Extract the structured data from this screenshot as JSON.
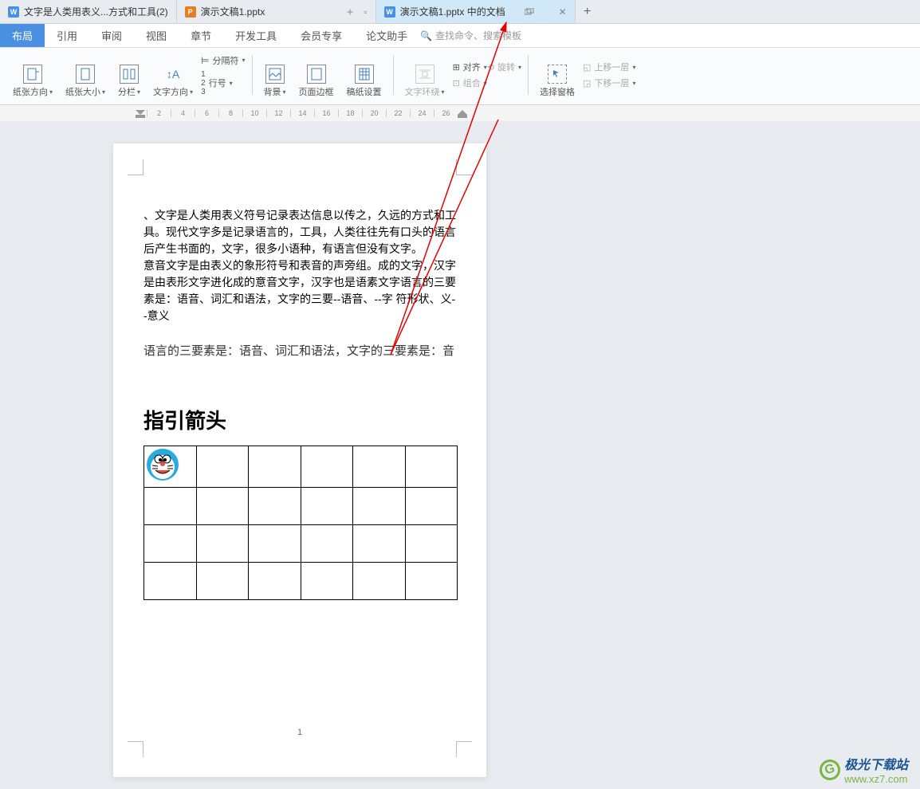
{
  "tabs": [
    {
      "label": "文字是人类用表义...方式和工具(2)",
      "icon": "word"
    },
    {
      "label": "演示文稿1.pptx",
      "icon": "ppt"
    },
    {
      "label": "演示文稿1.pptx 中的文档",
      "icon": "word"
    }
  ],
  "menu": {
    "items": [
      "布局",
      "引用",
      "审阅",
      "视图",
      "章节",
      "开发工具",
      "会员专享",
      "论文助手"
    ],
    "search_placeholder": "查找命令、搜索模板"
  },
  "ribbon": {
    "page_orient": "纸张方向",
    "page_size": "纸张大小",
    "columns": "分栏",
    "text_dir": "文字方向",
    "separator": "分隔符",
    "line_no": "行号",
    "background": "背景",
    "page_border": "页面边框",
    "draft_setup": "稿纸设置",
    "text_wrap": "文字环绕",
    "align": "对齐",
    "rotate": "旋转",
    "group": "组合",
    "selection_pane": "选择窗格",
    "move_up": "上移一层",
    "move_down": "下移一层"
  },
  "ruler": [
    "2",
    "4",
    "6",
    "8",
    "10",
    "12",
    "14",
    "16",
    "18",
    "20",
    "22",
    "24",
    "26"
  ],
  "document": {
    "para1": "、文字是人类用表义符号记录表达信息以传之，久远的方式和工具。现代文字多是记录语言的，工具，人类往往先有口头的语言后产生书面的，文字，很多小语种，有语言但没有文字。",
    "para2": "意音文字是由表义的象形符号和表音的声旁组。成的文字，汉字是由表形文字进化成的意音文字，汉字也是语素文字语言的三要素是：语音、词汇和语法，文字的三要--语音、--字 符形状、义--意义",
    "quote": "语言的三要素是：语音、词汇和语法，文字的三要素是：音",
    "heading": "指引箭头",
    "page_number": "1"
  },
  "watermark": {
    "text": "极光下载站",
    "url": "www.xz7.com"
  }
}
